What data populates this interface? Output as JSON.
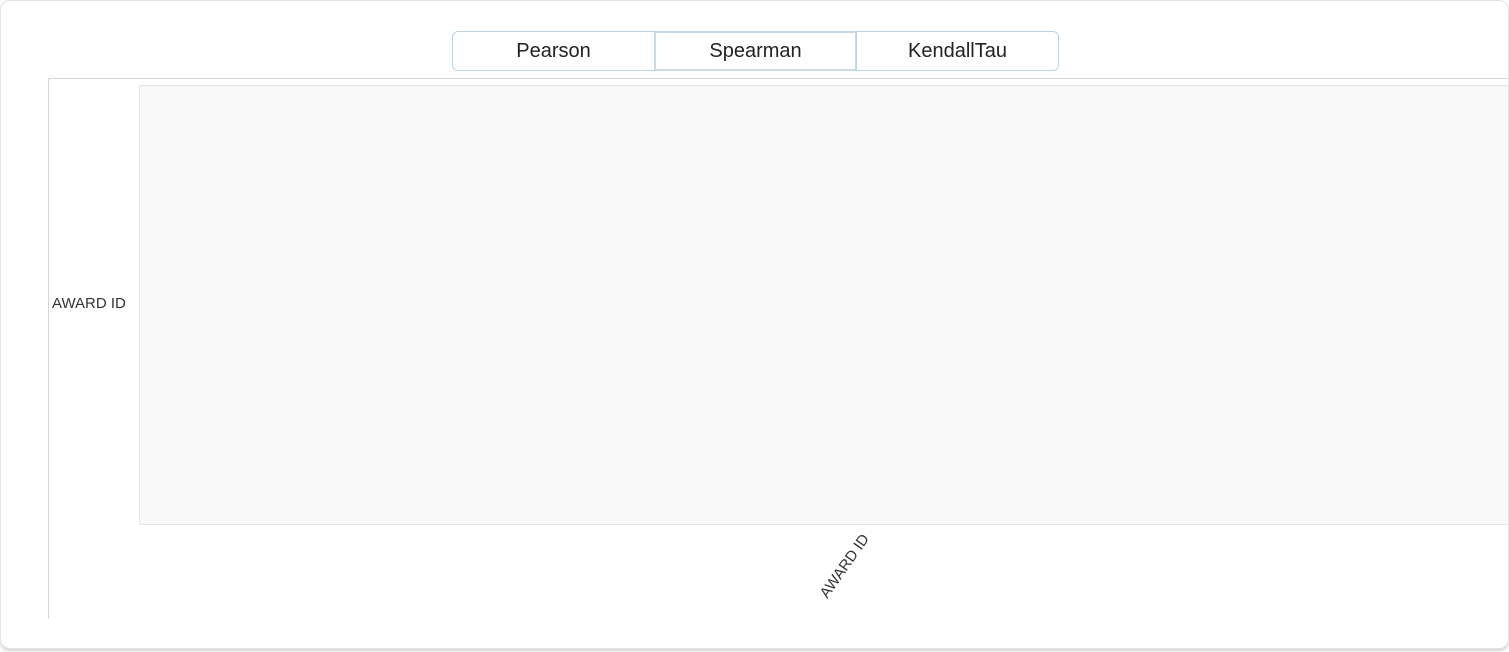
{
  "tabs": [
    {
      "label": "Pearson"
    },
    {
      "label": "Spearman"
    },
    {
      "label": "KendallTau"
    }
  ],
  "selected_tab": "Spearman",
  "chart_data": {
    "type": "heatmap",
    "title": "",
    "xlabel": "",
    "ylabel": "",
    "x": [
      "AWARD ID"
    ],
    "y": [
      "AWARD ID"
    ],
    "values": []
  },
  "colors": {
    "plot_background": "#f8f8f8",
    "tab_border": "#bcd3e0"
  }
}
